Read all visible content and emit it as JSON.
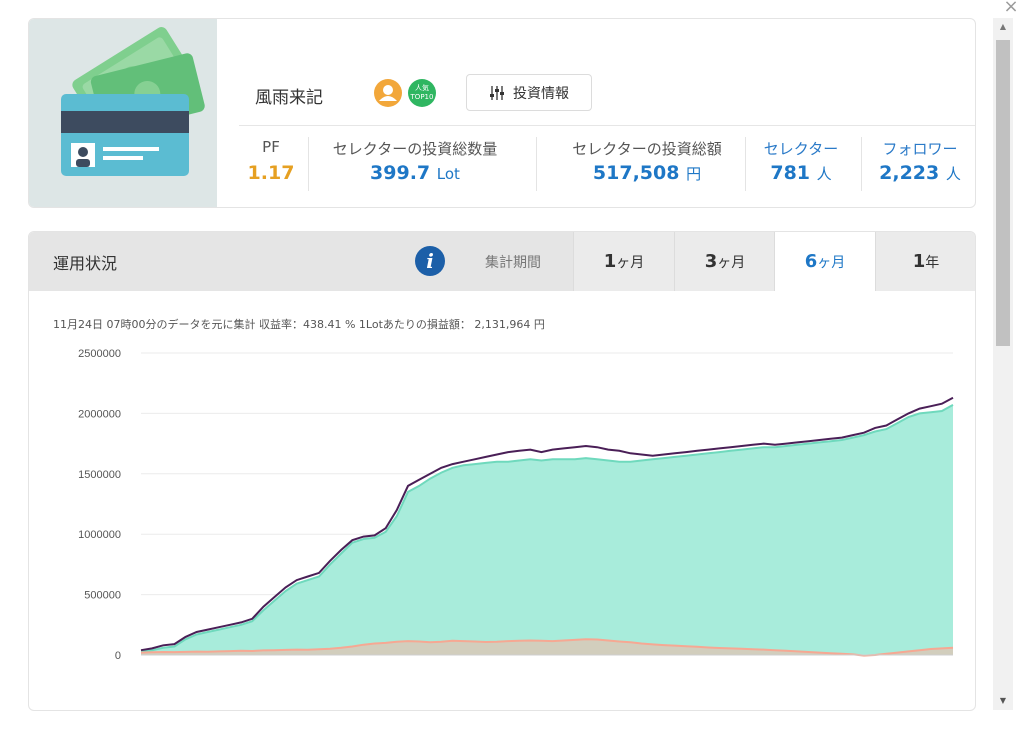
{
  "window": {
    "close_label": "×"
  },
  "profile": {
    "name": "風雨来記",
    "popular_badge": "人気 TOP10",
    "invest_info_button": "投資情報",
    "stats": [
      {
        "label": "PF",
        "value": "1.17",
        "unit": ""
      },
      {
        "label": "セレクターの投資総数量",
        "value": "399.7",
        "unit": "Lot"
      },
      {
        "label": "セレクターの投資総額",
        "value": "517,508",
        "unit": "円"
      },
      {
        "label": "セレクター",
        "value": "781",
        "unit": "人"
      },
      {
        "label": "フォロワー",
        "value": "2,223",
        "unit": "人"
      }
    ]
  },
  "performance": {
    "title": "運用状況",
    "period_label": "集計期間",
    "tabs": [
      {
        "num": "1",
        "unit": "ヶ月",
        "active": false
      },
      {
        "num": "3",
        "unit": "ヶ月",
        "active": false
      },
      {
        "num": "6",
        "unit": "ヶ月",
        "active": true
      },
      {
        "num": "1",
        "unit": "年",
        "active": false
      }
    ],
    "summary": "11月24日 07時00分のデータを元に集計 収益率：438.41 % 1Lotあたりの損益額： 2,131,964 円"
  },
  "colors": {
    "line": "#4a1f57",
    "area": "#a8ecdb",
    "area_stroke": "#6fd9bd",
    "pink": "#f6a893",
    "pink_fill": "#dcc7b5",
    "accent": "#1e77c6",
    "pf": "#e6a022"
  },
  "chart_data": {
    "type": "area",
    "ylim": [
      0,
      2500000
    ],
    "yticks": [
      0,
      500000,
      1000000,
      1500000,
      2000000,
      2500000
    ],
    "grid": true,
    "series": [
      {
        "values": [
          40000,
          55000,
          80000,
          90000,
          150000,
          190000,
          210000,
          230000,
          250000,
          270000,
          300000,
          400000,
          480000,
          560000,
          620000,
          650000,
          680000,
          780000,
          870000,
          950000,
          980000,
          990000,
          1050000,
          1200000,
          1400000,
          1450000,
          1500000,
          1550000,
          1580000,
          1600000,
          1620000,
          1640000,
          1660000,
          1680000,
          1690000,
          1700000,
          1680000,
          1700000,
          1710000,
          1720000,
          1730000,
          1720000,
          1700000,
          1690000,
          1670000,
          1660000,
          1650000,
          1660000,
          1670000,
          1680000,
          1690000,
          1700000,
          1710000,
          1720000,
          1730000,
          1740000,
          1750000,
          1740000,
          1750000,
          1760000,
          1770000,
          1780000,
          1790000,
          1800000,
          1820000,
          1840000,
          1880000,
          1900000,
          1950000,
          2000000,
          2040000,
          2060000,
          2080000,
          2130000
        ]
      },
      {
        "values": [
          30000,
          40000,
          60000,
          70000,
          130000,
          170000,
          190000,
          210000,
          230000,
          250000,
          280000,
          370000,
          450000,
          530000,
          590000,
          620000,
          650000,
          750000,
          840000,
          930000,
          960000,
          970000,
          1020000,
          1150000,
          1350000,
          1400000,
          1460000,
          1510000,
          1550000,
          1570000,
          1580000,
          1590000,
          1600000,
          1600000,
          1610000,
          1620000,
          1610000,
          1620000,
          1620000,
          1620000,
          1630000,
          1620000,
          1610000,
          1600000,
          1600000,
          1610000,
          1620000,
          1630000,
          1640000,
          1650000,
          1660000,
          1670000,
          1680000,
          1690000,
          1700000,
          1710000,
          1720000,
          1720000,
          1730000,
          1740000,
          1750000,
          1760000,
          1770000,
          1780000,
          1800000,
          1820000,
          1850000,
          1870000,
          1920000,
          1970000,
          2000000,
          2010000,
          2020000,
          2070000
        ]
      },
      {
        "values": [
          20000,
          22000,
          25000,
          24000,
          26000,
          28000,
          27000,
          30000,
          32000,
          35000,
          33000,
          38000,
          40000,
          42000,
          45000,
          43000,
          48000,
          52000,
          60000,
          70000,
          85000,
          95000,
          100000,
          110000,
          115000,
          112000,
          105000,
          110000,
          118000,
          115000,
          112000,
          108000,
          110000,
          115000,
          118000,
          120000,
          118000,
          115000,
          120000,
          125000,
          130000,
          128000,
          120000,
          112000,
          105000,
          95000,
          88000,
          82000,
          78000,
          72000,
          68000,
          62000,
          58000,
          55000,
          52000,
          48000,
          45000,
          40000,
          35000,
          30000,
          25000,
          20000,
          15000,
          10000,
          5000,
          -5000,
          0,
          10000,
          20000,
          30000,
          40000,
          50000,
          55000,
          60000
        ]
      }
    ]
  }
}
